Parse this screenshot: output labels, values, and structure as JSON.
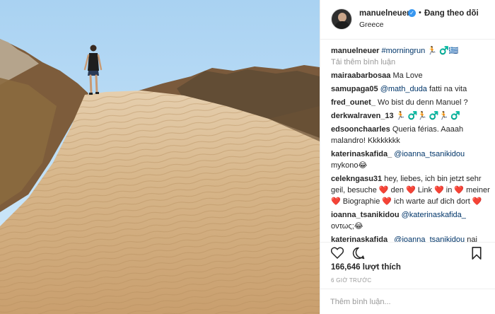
{
  "post": {
    "username": "manuelneuer",
    "verified_symbol": "✓",
    "separator": "•",
    "follow_status": "Đang theo dõi",
    "location": "Greece",
    "caption_user": "manuelneuer",
    "caption_text": "#morningrun 🏃 ♂️🇬🇷",
    "load_more": "Tải thêm bình luận",
    "likes": "166,646 lượt thích",
    "time": "6 GIỜ TRƯỚC",
    "comment_placeholder": "Thêm bình luận..."
  },
  "comments": [
    {
      "user": "mairaabarbosaa",
      "mention": "",
      "text": "Ma Love"
    },
    {
      "user": "samupaga05",
      "mention": "@math_duda",
      "text": "fatti na vita"
    },
    {
      "user": "fred_ounet_",
      "mention": "",
      "text": "Wo bist du denn Manuel ?"
    },
    {
      "user": "derkwalraven_13",
      "mention": "",
      "text": "🏃 ♂️🏃 ♂️🏃 ♂️"
    },
    {
      "user": "edsoonchaarles",
      "mention": "",
      "text": "Queria férias. Aaaah malandro! Kkkkkkkk"
    },
    {
      "user": "katerinaskafida_",
      "mention": "@ioanna_tsanikidou",
      "text": "mykono😂"
    },
    {
      "user": "celekngasu31",
      "mention": "",
      "text": "hey, liebes, ich bin jetzt sehr geil, besuche ❤️ den ❤️ Link ❤️ in ❤️ meiner❤️ Biographie ❤️ ich warte auf dich dort ❤️"
    },
    {
      "user": "ioanna_tsanikidou",
      "mention": "@katerinaskafida_",
      "text": "οντως;😂"
    },
    {
      "user": "katerinaskafida_",
      "mention": "@ioanna_tsanikidou",
      "text": "nai"
    }
  ],
  "icons": {
    "like": "heart-icon",
    "comment": "comment-icon",
    "save": "bookmark-icon"
  },
  "colors": {
    "sky": "#bfe0f7",
    "sand": "#d9b98e",
    "link": "#003569",
    "verified": "#3897f0"
  }
}
